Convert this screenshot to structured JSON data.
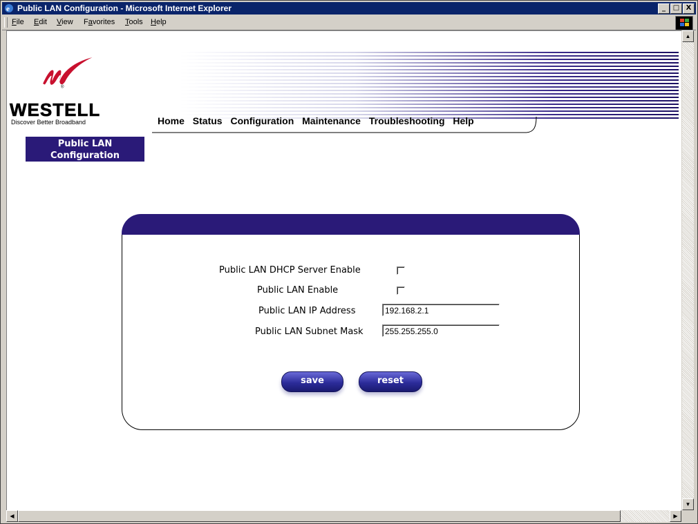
{
  "window": {
    "title": "Public LAN Configuration - Microsoft Internet Explorer",
    "buttons": [
      "_",
      "□",
      "X"
    ]
  },
  "menu": [
    {
      "label": "File",
      "key": "F"
    },
    {
      "label": "Edit",
      "key": "E"
    },
    {
      "label": "View",
      "key": "V"
    },
    {
      "label": "Favorites",
      "key": "a"
    },
    {
      "label": "Tools",
      "key": "T"
    },
    {
      "label": "Help",
      "key": "H"
    }
  ],
  "brand": {
    "name": "WESTELL",
    "tagline": "Discover Better Broadband",
    "registered": "®"
  },
  "nav": [
    "Home",
    "Status",
    "Configuration",
    "Maintenance",
    "Troubleshooting",
    "Help"
  ],
  "page_label": "Public LAN Configuration",
  "form": {
    "dhcp_label": "Public LAN DHCP Server Enable",
    "dhcp_checked": false,
    "enable_label": "Public LAN Enable",
    "enable_checked": false,
    "ip_label": "Public LAN IP Address",
    "ip_value": "192.168.2.1",
    "mask_label": "Public LAN Subnet Mask",
    "mask_value": "255.255.255.0",
    "save_label": "save",
    "reset_label": "reset"
  },
  "colors": {
    "accent": "#2a1a78",
    "brand_red": "#c8102e",
    "title_bar": "#0a246a"
  }
}
